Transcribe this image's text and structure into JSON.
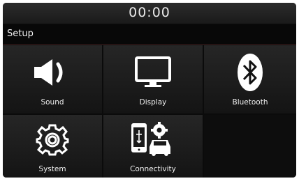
{
  "status": {
    "clock": "00:00"
  },
  "header": {
    "title": "Setup"
  },
  "tiles": [
    {
      "label": "Sound",
      "icon": "speaker-icon"
    },
    {
      "label": "Display",
      "icon": "monitor-icon"
    },
    {
      "label": "Bluetooth",
      "icon": "bluetooth-icon"
    },
    {
      "label": "System",
      "icon": "gear-icon"
    },
    {
      "label": "Connectivity",
      "icon": "phone-car-gear-icon"
    }
  ],
  "colors": {
    "tile_bg": "#1e1e1e",
    "text": "#efefef",
    "icon": "#ffffff"
  }
}
